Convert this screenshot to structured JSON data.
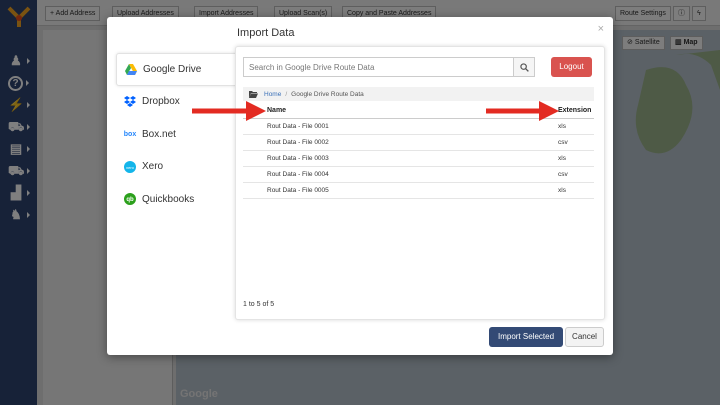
{
  "toolbar": {
    "buttons": [
      "+ Add Address",
      "Upload Addresses",
      "Import Addresses",
      "Upload Scan(s)",
      "Copy and Paste Addresses"
    ],
    "route_settings": "Route Settings"
  },
  "map": {
    "satellite": "Satellite",
    "map": "Map",
    "google": "Google"
  },
  "modal": {
    "title": "Import Data",
    "close": "×",
    "providers": [
      {
        "label": "Google Drive",
        "icon": "google-drive-icon",
        "active": true
      },
      {
        "label": "Dropbox",
        "icon": "dropbox-icon",
        "active": false
      },
      {
        "label": "Box.net",
        "icon": "box-icon",
        "active": false
      },
      {
        "label": "Xero",
        "icon": "xero-icon",
        "active": false
      },
      {
        "label": "Quickbooks",
        "icon": "quickbooks-icon",
        "active": false
      }
    ],
    "search": {
      "placeholder": "Search in Google Drive Route Data"
    },
    "logout": "Logout",
    "breadcrumb": {
      "home": "Home",
      "separator": "/",
      "current": "Google Drive Route Data"
    },
    "table": {
      "headers": {
        "name": "Name",
        "extension": "Extension"
      },
      "rows": [
        {
          "name": "Rout Data - File 0001",
          "ext": "xls"
        },
        {
          "name": "Rout Data - File 0002",
          "ext": "csv"
        },
        {
          "name": "Rout Data - File 0003",
          "ext": "xls"
        },
        {
          "name": "Rout Data - File 0004",
          "ext": "csv"
        },
        {
          "name": "Rout Data - File 0005",
          "ext": "xls"
        }
      ]
    },
    "pager": "1 to 5 of 5",
    "import_selected": "Import Selected",
    "cancel": "Cancel"
  },
  "colors": {
    "sidebar": "#2f4471",
    "logout": "#d9534f",
    "primary": "#334a75",
    "arrow": "#e32b22"
  }
}
